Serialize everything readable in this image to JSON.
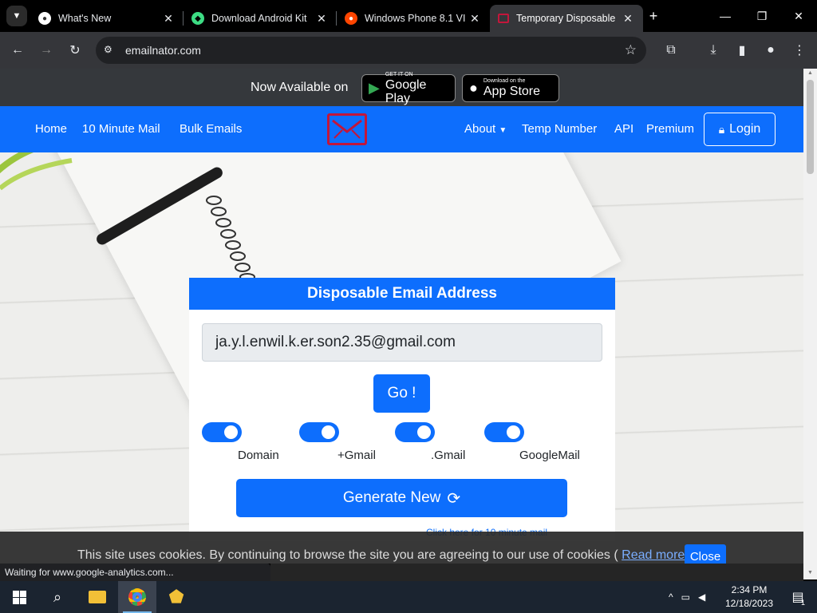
{
  "browser": {
    "tabs": [
      {
        "title": "What's New",
        "active": false
      },
      {
        "title": "Download Android Kit",
        "active": false
      },
      {
        "title": "Windows Phone 8.1 VI",
        "active": false
      },
      {
        "title": "Temporary Disposable",
        "active": true
      }
    ],
    "url": "emailnator.com",
    "status_text": "Waiting for www.google-analytics.com..."
  },
  "site": {
    "available_text": "Now Available on",
    "google_play": {
      "small": "GET IT ON",
      "big": "Google Play"
    },
    "app_store": {
      "small": "Download on the",
      "big": "App Store"
    },
    "nav_left": [
      "Home",
      "10 Minute Mail",
      "Bulk Emails"
    ],
    "nav_right": [
      "About",
      "Temp Number",
      "API",
      "Premium"
    ],
    "login_label": "Login",
    "card": {
      "title": "Disposable Email Address",
      "email_value": "ja.y.l.enwil.k.er.son2.35@gmail.com",
      "go_label": "Go !",
      "toggles": [
        {
          "label": "Domain",
          "on": true
        },
        {
          "label": "+Gmail",
          "on": true
        },
        {
          "label": ".Gmail",
          "on": true
        },
        {
          "label": "GoogleMail",
          "on": true
        }
      ],
      "generate_label": "Generate New",
      "ten_min_link": "Click here for 10 minute mail"
    },
    "cookie": {
      "text": "This site uses cookies. By continuing to browse the site you are agreeing to our use of cookies (",
      "link": "Read more",
      "close_label": "Close"
    }
  },
  "taskbar": {
    "time": "2:34 PM",
    "date": "12/18/2023",
    "notification_count": "1"
  },
  "colors": {
    "primary": "#0d6efd",
    "logo": "#c2163b"
  }
}
